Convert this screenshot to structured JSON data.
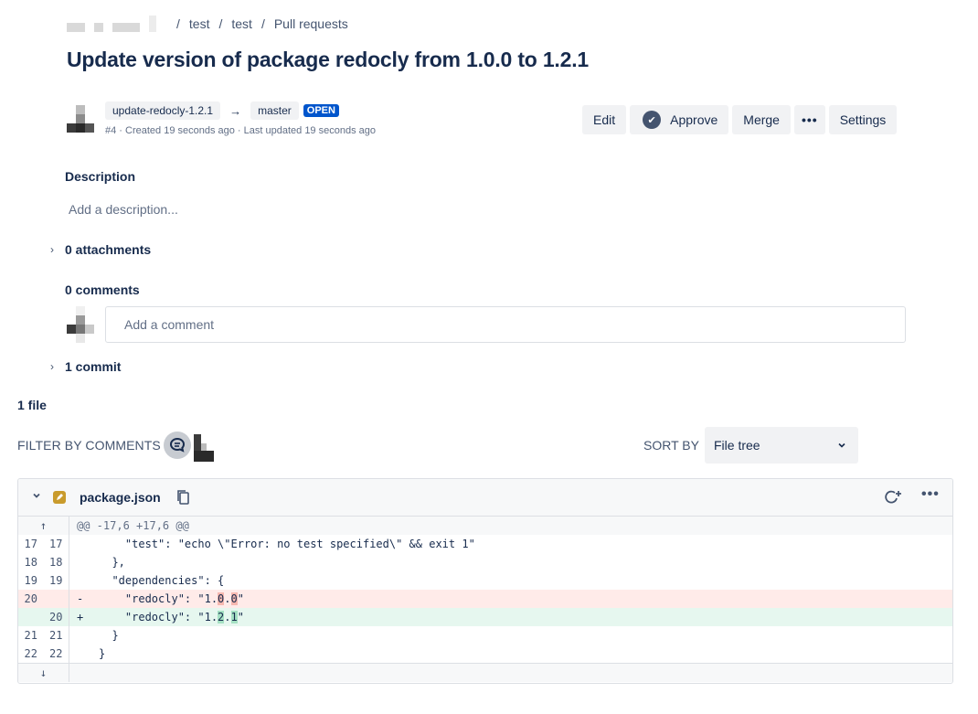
{
  "breadcrumb": {
    "items": [
      "test",
      "test",
      "Pull requests"
    ],
    "separator": "/"
  },
  "pr": {
    "title": "Update version of package redocly from 1.0.0 to 1.2.1",
    "source_branch": "update-redocly-1.2.1",
    "arrow": "→",
    "target_branch": "master",
    "status": "OPEN",
    "meta": "#4 · Created 19 seconds ago · Last updated 19 seconds ago"
  },
  "actions": {
    "edit": "Edit",
    "approve": "Approve",
    "merge": "Merge",
    "more": "•••",
    "settings": "Settings"
  },
  "description": {
    "heading": "Description",
    "placeholder": "Add a description..."
  },
  "attachments": {
    "label": "0 attachments"
  },
  "comments": {
    "heading": "0 comments",
    "placeholder": "Add a comment"
  },
  "commits": {
    "label": "1 commit"
  },
  "files": {
    "heading": "1 file"
  },
  "filter": {
    "label": "FILTER BY COMMENTS"
  },
  "sort": {
    "label": "SORT BY",
    "selected": "File tree"
  },
  "diff": {
    "filename": "package.json",
    "hunk": "@@ -17,6 +17,6 @@",
    "lines": [
      {
        "type": "ctx",
        "old": "17",
        "new": "17",
        "sign": "",
        "text": "    \"test\": \"echo \\\"Error: no test specified\\\" && exit 1\""
      },
      {
        "type": "ctx",
        "old": "18",
        "new": "18",
        "sign": "",
        "text": "  },"
      },
      {
        "type": "ctx",
        "old": "19",
        "new": "19",
        "sign": "",
        "text": "  \"dependencies\": {"
      },
      {
        "type": "del",
        "old": "20",
        "new": "",
        "sign": "-",
        "pre": "    \"redocly\": \"1.",
        "h1": "0",
        "mid": ".",
        "h2": "0",
        "post": "\""
      },
      {
        "type": "add",
        "old": "",
        "new": "20",
        "sign": "+",
        "pre": "    \"redocly\": \"1.",
        "h1": "2",
        "mid": ".",
        "h2": "1",
        "post": "\""
      },
      {
        "type": "ctx",
        "old": "21",
        "new": "21",
        "sign": "",
        "text": "  }"
      },
      {
        "type": "ctx",
        "old": "22",
        "new": "22",
        "sign": "",
        "text": "}"
      }
    ]
  },
  "colors": {
    "accent": "#0055cc",
    "deleted_bg": "#ffebe9",
    "added_bg": "#e6f7ef",
    "badge": "#0055cc"
  },
  "icons": [
    "arrow-right-icon",
    "check-circle-icon",
    "chevron-right-icon",
    "comment-filter-icon",
    "chevron-down-icon",
    "pencil-icon",
    "copy-icon",
    "refresh-comment-icon",
    "more-icon",
    "arrow-up-icon",
    "arrow-down-icon"
  ]
}
